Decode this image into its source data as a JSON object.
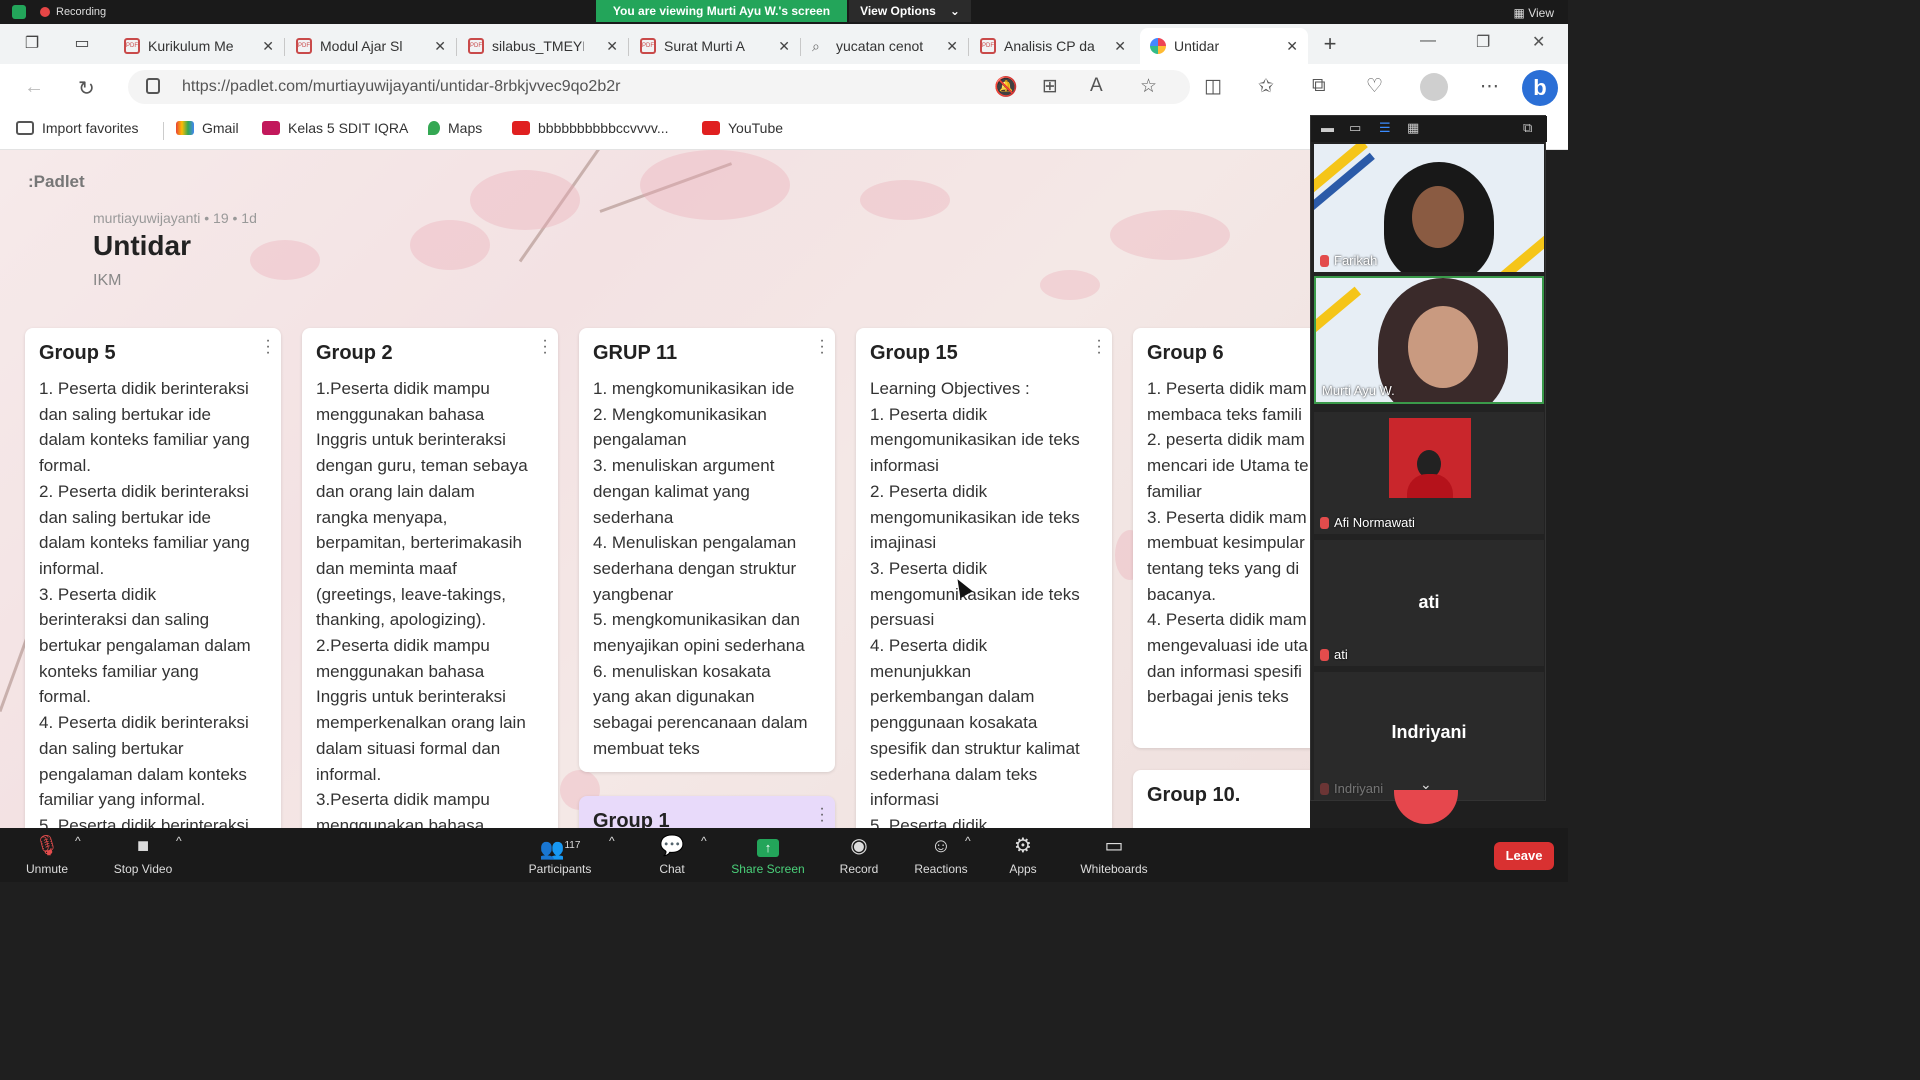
{
  "zoom_top": {
    "recording_label": "Recording",
    "viewing_banner": "You are viewing Murti Ayu W.'s screen",
    "view_options": "View Options",
    "view_label": "View"
  },
  "browser": {
    "tabs": [
      {
        "title": "Kurikulum Me"
      },
      {
        "title": "Modul Ajar Sl"
      },
      {
        "title": "silabus_TMEYI"
      },
      {
        "title": "Surat Murti A"
      },
      {
        "title": "yucatan cenot"
      },
      {
        "title": "Analisis CP da"
      },
      {
        "title": "Untidar"
      }
    ],
    "url": "https://padlet.com/murtiayuwijayanti/untidar-8rbkjvvec9qo2b2r",
    "bookmarks": [
      {
        "label": "Import favorites"
      },
      {
        "label": "Gmail"
      },
      {
        "label": "Kelas 5 SDIT IQRA"
      },
      {
        "label": "Maps"
      },
      {
        "label": "bbbbbbbbbbccvvvv..."
      },
      {
        "label": "YouTube"
      }
    ]
  },
  "padlet": {
    "logo": ":Padlet",
    "meta": "murtiayuwijayanti  • 19  • 1d",
    "title": "Untidar",
    "subtitle": "IKM",
    "cards": [
      {
        "title": "Group 5",
        "body": "1. Peserta didik berinteraksi\ndan saling bertukar ide\ndalam konteks familiar yang\nformal.\n2. Peserta didik berinteraksi\ndan saling bertukar ide\ndalam konteks familiar yang\ninformal.\n3.  Peserta didik\nberinteraksi dan saling\nbertukar pengalaman dalam\nkonteks familiar yang\nformal.\n4. Peserta didik berinteraksi\ndan saling bertukar\npengalaman dalam konteks\nfamiliar yang informal.\n5. Peserta didik berinteraksi"
      },
      {
        "title": "Group 2",
        "body": "1.Peserta didik mampu\nmenggunakan bahasa\nInggris untuk berinteraksi\ndengan guru, teman sebaya\ndan orang lain  dalam\nrangka menyapa,\nberpamitan, berterimakasih\ndan meminta maaf\n(greetings, leave-takings,\nthanking, apologizing).\n2.Peserta didik mampu\nmenggunakan bahasa\nInggris untuk berinteraksi\nmemperkenalkan orang lain\ndalam situasi formal dan\ninformal.\n3.Peserta didik mampu\nmenggunakan bahasa"
      },
      {
        "title": "GRUP 11",
        "body": "1. mengkomunikasikan ide\n2. Mengkomunikasikan\npengalaman\n3. menuliskan argument\ndengan kalimat yang\nsederhana\n4. Menuliskan pengalaman\nsederhana dengan struktur\nyangbenar\n5. mengkomunikasikan dan\nmenyajikan opini sederhana\n6. menuliskan kosakata\nyang akan digunakan\nsebagai perencanaan dalam\nmembuat teks"
      },
      {
        "title": "Group 1",
        "body": ""
      },
      {
        "title": "Group 15",
        "body": "Learning Objectives :\n1. Peserta didik\nmengomunikasikan ide teks\ninformasi\n2. Peserta didik\nmengomunikasikan ide teks\nimajinasi\n3. Peserta didik\nmengomunikasikan ide teks\npersuasi\n4. Peserta didik\nmenunjukkan\nperkembangan dalam\npenggunaan kosakata\nspesifik dan struktur kalimat\nsederhana dalam teks\ninformasi\n5. Peserta didik"
      },
      {
        "title": "Group 6",
        "body": "1. Peserta didik mam\nmembaca teks famili\n2. peserta didik mam\nmencari ide Utama te\nfamiliar\n3. Peserta didik mam\nmembuat kesimpular\ntentang teks yang di\nbacanya.\n4. Peserta didik mam\nmengevaluasi ide uta\ndan informasi spesifi\nberbagai jenis teks"
      },
      {
        "title": "Group 10.",
        "body": ""
      }
    ]
  },
  "participants": [
    {
      "name": "Farikah"
    },
    {
      "name": "Murti Ayu W."
    },
    {
      "name": "Afi Normawati"
    },
    {
      "name": "ati",
      "display": "ati"
    },
    {
      "name": "Indriyani",
      "display": "Indriyani"
    }
  ],
  "zoom_bottom": {
    "unmute": "Unmute",
    "stop_video": "Stop Video",
    "participants": "Participants",
    "participants_count": "117",
    "chat": "Chat",
    "share_screen": "Share Screen",
    "record": "Record",
    "reactions": "Reactions",
    "apps": "Apps",
    "whiteboards": "Whiteboards",
    "leave": "Leave"
  },
  "colors": {
    "zoom_green": "#23a55a",
    "leave_red": "#d93131",
    "group1_card": "#e8dafa"
  }
}
